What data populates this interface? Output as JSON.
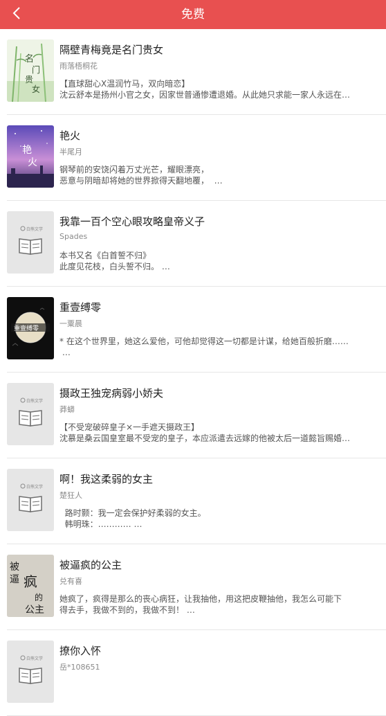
{
  "header": {
    "title": "免费",
    "back_icon": "chevron-left-icon",
    "background": "#e85050"
  },
  "books": [
    {
      "title": "隔壁青梅竟是名门贵女",
      "author": "雨落梧桐花",
      "desc": "【直球甜心X温润竹马，双向暗恋】\n沈云舒本是扬州小官之女，因家世普通惨遭退婚。从此她只求能一家人永远在…",
      "cover_style": "bamboo",
      "cover_text": "名门贵女"
    },
    {
      "title": "艳火",
      "author": "半尾月",
      "desc": "钢琴前的安饶闪着万丈光芒，耀眼漂亮，\n恶意与阴暗却将她的世界掀得天翻地覆，  …",
      "cover_style": "night-sky",
      "cover_text": "艳火"
    },
    {
      "title": "我靠一百个空心眼攻略皇帝义子",
      "author": "Spades",
      "desc": "本书又名《白首誓不归》\n此度见花枝，白头誓不归。 …",
      "cover_style": "placeholder",
      "cover_text": "白熊文学"
    },
    {
      "title": "重壹缚零",
      "author": "一粟晨",
      "desc": "* 在这个世界里，她这么爱他，可他却觉得这一切都是计谋，给她百般折磨……\n …",
      "cover_style": "moon",
      "cover_text": "重壹缚零"
    },
    {
      "title": "摄政王独宠病弱小娇夫",
      "author": "莽蟒",
      "desc": "【不受宠破碎皇子×一手遮天摄政王】\n沈慕是桑云国皇室最不受宠的皇子，本应派遣去远嫁的他被太后一道懿旨赐婚…",
      "cover_style": "placeholder",
      "cover_text": "白熊文学"
    },
    {
      "title": "啊！我这柔弱的女主",
      "author": "楚狂人",
      "desc": "  路时颢：我一定会保护好柔弱的女主。\n  韩明珠：………… …",
      "cover_style": "placeholder",
      "cover_text": "白熊文学"
    },
    {
      "title": "被逼疯的公主",
      "author": "兑有喜",
      "desc": "她疯了，疯得是那么的丧心病狂，让我抽他，用这把皮鞭抽他，我怎么可能下\n得去手，我做不到的，我做不到！ …",
      "cover_style": "calligraphy",
      "cover_text": "被逼疯的公主"
    },
    {
      "title": "撩你入怀",
      "author": "岳*108651",
      "desc": "",
      "cover_style": "placeholder",
      "cover_text": "白熊文学"
    }
  ]
}
